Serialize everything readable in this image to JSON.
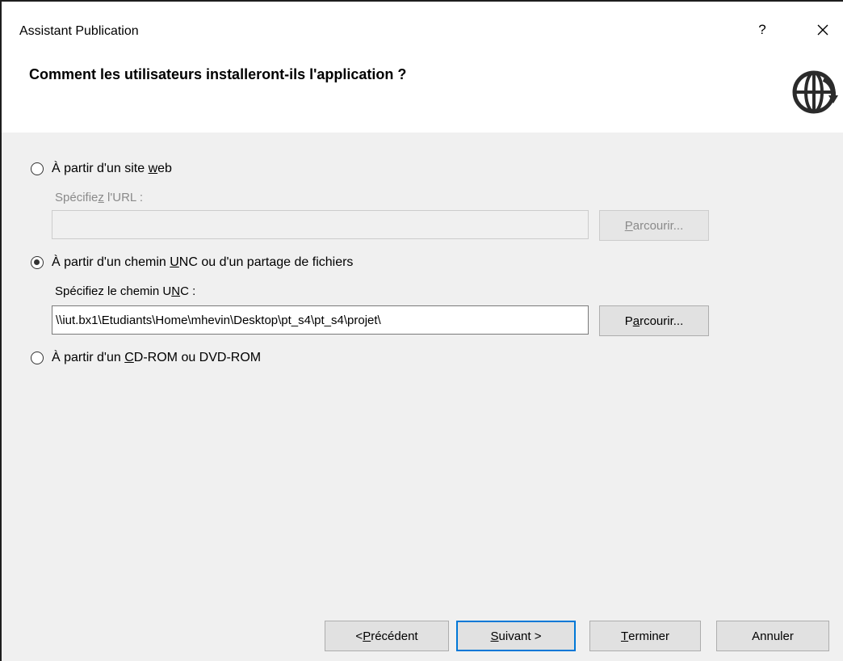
{
  "window": {
    "title": "Assistant Publication",
    "help_label": "?"
  },
  "header": {
    "title": "Comment les utilisateurs installeront-ils l'application ?"
  },
  "options": [
    {
      "label_pre": "À partir d'un site ",
      "label_u": "w",
      "label_post": "eb",
      "checked": false,
      "field_label_pre": "Spécifie",
      "field_label_u": "z",
      "field_label_post": " l'URL :",
      "input_value": "",
      "browse_pre": "",
      "browse_u": "P",
      "browse_post": "arcourir...",
      "enabled": false
    },
    {
      "label_pre": "À partir d'un chemin ",
      "label_u": "U",
      "label_post": "NC ou d'un partage de fichiers",
      "checked": true,
      "field_label_pre": "Spécifiez le chemin U",
      "field_label_u": "N",
      "field_label_post": "C :",
      "input_value": "\\\\iut.bx1\\Etudiants\\Home\\mhevin\\Desktop\\pt_s4\\pt_s4\\projet\\",
      "browse_pre": "P",
      "browse_u": "a",
      "browse_post": "rcourir...",
      "enabled": true
    },
    {
      "label_pre": "À partir d'un ",
      "label_u": "C",
      "label_post": "D-ROM ou DVD-ROM",
      "checked": false
    }
  ],
  "footer": {
    "previous_pre": "< ",
    "previous_u": "P",
    "previous_post": "récédent",
    "next_u": "S",
    "next_post": "uivant >",
    "finish_u": "T",
    "finish_post": "erminer",
    "cancel_label": "Annuler"
  },
  "colors": {
    "content_bg": "#f0f0f0",
    "accent": "#0078d7",
    "disabled_text": "#8a8a8a"
  },
  "icons": {
    "close": "close-icon",
    "globe": "globe-arrow-icon"
  }
}
